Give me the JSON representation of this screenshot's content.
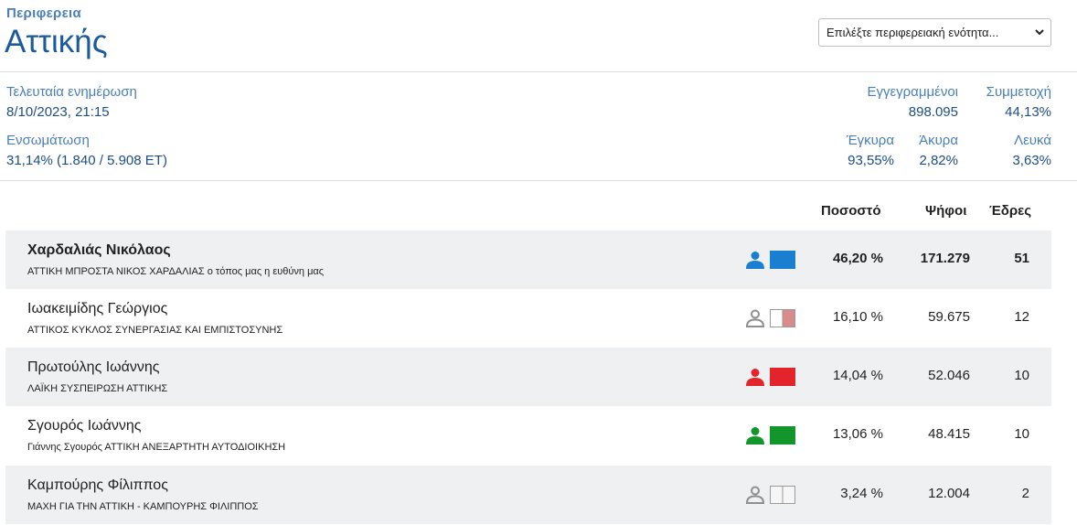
{
  "header": {
    "region_label": "Περιφερεια",
    "region_name": "Αττικής",
    "unit_select": "Επιλέξτε περιφερειακή ενότητα..."
  },
  "stats": {
    "last_update_label": "Τελευταία ενημέρωση",
    "last_update_value": "8/10/2023, 21:15",
    "integration_label": "Ενσωμάτωση",
    "integration_value": "31,14% (1.840 / 5.908 ΕΤ)",
    "registered_label": "Εγγεγραμμένοι",
    "registered_value": "898.095",
    "turnout_label": "Συμμετοχή",
    "turnout_value": "44,13%",
    "valid_label": "Έγκυρα",
    "valid_value": "93,55%",
    "invalid_label": "Άκυρα",
    "invalid_value": "2,82%",
    "blank_label": "Λευκά",
    "blank_value": "3,63%"
  },
  "table": {
    "col_percent": "Ποσοστό",
    "col_votes": "Ψήφοι",
    "col_seats": "Έδρες",
    "rows": [
      {
        "candidate": "Χαρδαλιάς Νικόλαος",
        "party": "ΑΤΤΙΚΗ ΜΠΡΟΣΤΑ ΝΙΚΟΣ ΧΑΡΔΑΛΙΑΣ ο τόπος μας η ευθύνη μας",
        "percent": "46,20 %",
        "votes": "171.279",
        "seats": "51",
        "icon_color": "#1a7fd0",
        "swatch_left": "#1a7fd0",
        "swatch_right": "#1a7fd0"
      },
      {
        "candidate": "Ιωακειμίδης Γεώργιος",
        "party": "ΑΤΤΙΚΟΣ ΚΥΚΛΟΣ ΣΥΝΕΡΓΑΣΙΑΣ ΚΑΙ ΕΜΠΙΣΤΟΣΥΝΗΣ",
        "percent": "16,10 %",
        "votes": "59.675",
        "seats": "12",
        "icon_color": "#8f8f8f",
        "swatch_left": "#ffffff",
        "swatch_right": "#d98b8b"
      },
      {
        "candidate": "Πρωτούλης Ιωάννης",
        "party": "ΛΑΪΚΗ ΣΥΣΠΕΙΡΩΣΗ ΑΤΤΙΚΗΣ",
        "percent": "14,04 %",
        "votes": "52.046",
        "seats": "10",
        "icon_color": "#e3242b",
        "swatch_left": "#e3242b",
        "swatch_right": "#e3242b"
      },
      {
        "candidate": "Σγουρός Ιωάννης",
        "party": "Γιάννης Σγουρός ΑΤΤΙΚΗ ΑΝΕΞΑΡΤΗΤΗ ΑΥΤΟΔΙΟΙΚΗΣΗ",
        "percent": "13,06 %",
        "votes": "48.415",
        "seats": "10",
        "icon_color": "#12962b",
        "swatch_left": "#12962b",
        "swatch_right": "#12962b"
      },
      {
        "candidate": "Καμπούρης Φίλιππος",
        "party": "ΜΑΧΗ ΓΙΑ ΤΗΝ ΑΤΤΙΚΗ - ΚΑΜΠΟΥΡΗΣ ΦΙΛΙΠΠΟΣ",
        "percent": "3,24 %",
        "votes": "12.004",
        "seats": "2",
        "icon_color": "#8f8f8f",
        "swatch_left": "#f6f6f6",
        "swatch_right": "#f6f6f6"
      }
    ]
  }
}
